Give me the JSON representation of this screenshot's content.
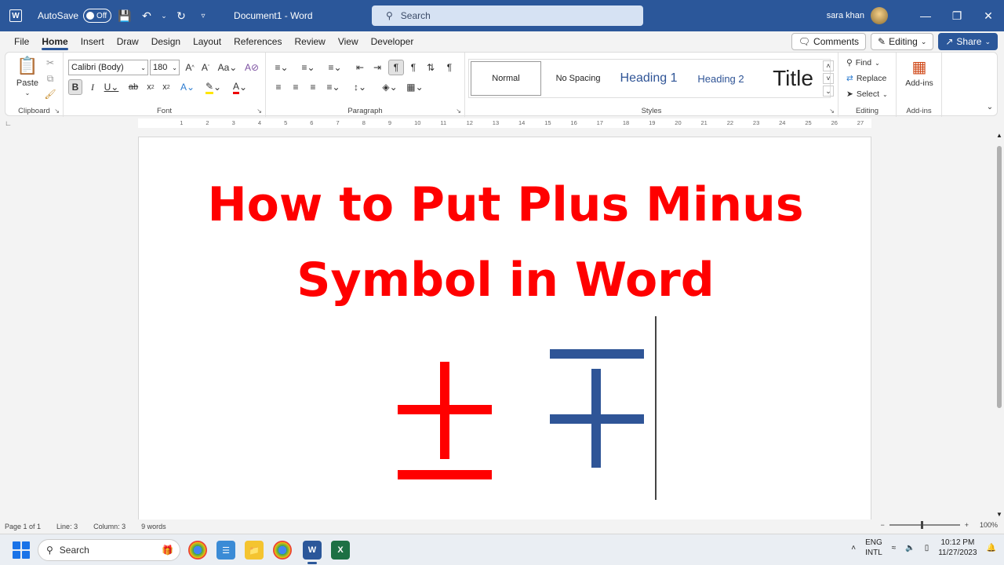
{
  "titlebar": {
    "autosave_label": "AutoSave",
    "autosave_state": "Off",
    "doc_title": "Document1 - Word",
    "search_placeholder": "Search",
    "username": "sara khan"
  },
  "menu": {
    "tabs": [
      "File",
      "Home",
      "Insert",
      "Draw",
      "Design",
      "Layout",
      "References",
      "Review",
      "View",
      "Developer"
    ],
    "active_tab": "Home",
    "comments_label": "Comments",
    "editing_label": "Editing",
    "share_label": "Share"
  },
  "ribbon": {
    "clipboard": {
      "label": "Clipboard",
      "paste": "Paste"
    },
    "font": {
      "label": "Font",
      "family": "Calibri (Body)",
      "size": "180"
    },
    "paragraph": {
      "label": "Paragraph"
    },
    "styles": {
      "label": "Styles",
      "items": [
        "Normal",
        "No Spacing",
        "Heading 1",
        "Heading 2",
        "Title"
      ]
    },
    "editing": {
      "label": "Editing",
      "find": "Find",
      "replace": "Replace",
      "select": "Select"
    },
    "addins": {
      "label": "Add-ins",
      "button": "Add-ins"
    }
  },
  "ruler": {
    "ticks": [
      "1",
      "2",
      "3",
      "4",
      "5",
      "6",
      "7",
      "8",
      "9",
      "10",
      "11",
      "12",
      "13",
      "14",
      "15",
      "16",
      "17",
      "18",
      "19",
      "20",
      "21",
      "22",
      "23",
      "24",
      "25",
      "26",
      "27"
    ]
  },
  "document": {
    "heading_line1": "How to Put Plus Minus",
    "heading_line2": "Symbol in Word",
    "plus_minus_color": "#ff0000",
    "minus_plus_color": "#2f5597"
  },
  "statusbar": {
    "page": "Page 1 of 1",
    "line": "Line: 3",
    "column": "Column: 3",
    "words": "9 words",
    "zoom": "100%"
  },
  "taskbar": {
    "search_label": "Search",
    "lang_line1": "ENG",
    "lang_line2": "INTL",
    "time": "10:12 PM",
    "date": "11/27/2023"
  }
}
